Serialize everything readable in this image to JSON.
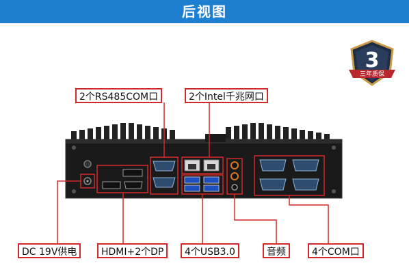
{
  "header": {
    "title": "后视图"
  },
  "badge": {
    "number": "3",
    "caption": "三年质保"
  },
  "labels": {
    "rs485": "2个RS485COM口",
    "lan": "2个Intel千兆网口",
    "dc": "DC 19V供电",
    "video": "HDMI+2个DP",
    "usb": "4个USB3.0",
    "audio": "音频",
    "com": "4个COM口"
  },
  "colors": {
    "header_bg": "#1e7fd0",
    "highlight": "#d12a2a",
    "chassis": "#1a1a1a"
  },
  "icons": [
    "shield-badge-icon"
  ]
}
